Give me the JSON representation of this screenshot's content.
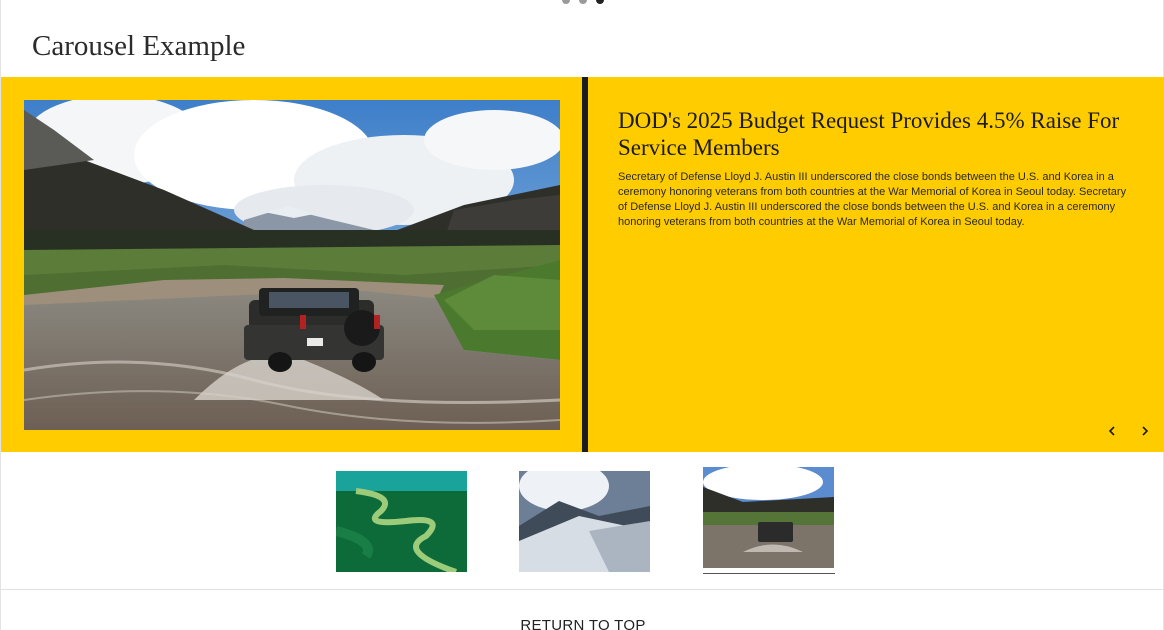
{
  "page": {
    "title": "Carousel Example"
  },
  "carousel": {
    "background_color": "#ffcc00",
    "active_slide": 3,
    "slide": {
      "heading": "DOD's 2025 Budget Request Provides 4.5% Raise For Service Members",
      "body": "Secretary of Defense Lloyd J. Austin III underscored the close bonds between the U.S. and Korea in a ceremony honoring veterans from both countries at the War Memorial of Korea in Seoul today. Secretary of Defense Lloyd J. Austin III underscored the close bonds between the U.S. and Korea in a ceremony honoring veterans from both countries at the War Memorial of Korea in Seoul today.",
      "image": "offroad-vehicle-river-crossing"
    },
    "prev_icon": "chevron-left-icon",
    "next_icon": "chevron-right-icon",
    "thumbnails": [
      {
        "image": "winding-river-aerial",
        "active": false
      },
      {
        "image": "snowy-mountain-slope",
        "active": false
      },
      {
        "image": "offroad-vehicle-river-crossing",
        "active": true
      }
    ]
  },
  "footer": {
    "return_to_top": "RETURN TO TOP"
  }
}
